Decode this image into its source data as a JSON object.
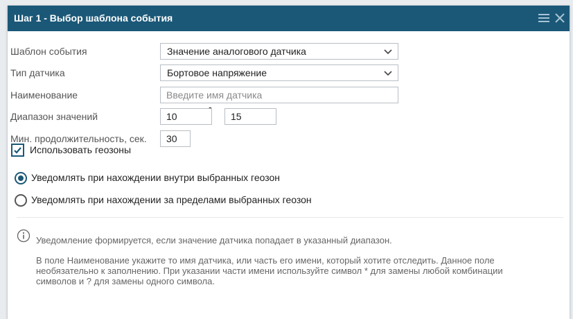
{
  "dialog": {
    "title": "Шаг 1 - Выбор шаблона события",
    "menu_icon": "hamburger-menu-icon",
    "close_icon": "close-icon"
  },
  "form": {
    "template_label": "Шаблон события",
    "template_value": "Значение аналогового датчика",
    "sensor_type_label": "Тип датчика",
    "sensor_type_value": "Бортовое напряжение",
    "name_label": "Наименование",
    "name_placeholder": "Введите имя датчика",
    "name_value": "",
    "range_label": "Диапазон значений",
    "range_from": "10",
    "range_sep": "-",
    "range_to": "15",
    "duration_label": "Мин. продолжительность, сек.",
    "duration_value": "30",
    "geozones_label": "Использовать геозоны",
    "geozones_checked": true,
    "radio_inside_label": "Уведомлять при нахождении внутри выбранных геозон",
    "radio_outside_label": "Уведомлять при нахождении за пределами выбранных геозон",
    "radio_selected": "inside"
  },
  "info": {
    "line1": "Уведомление формируется, если значение датчика попадает в указанный диапазон.",
    "paragraph": "В поле Наименование укажите то имя датчика, или часть его имени, который хотите отследить. Данное поле необязательно к заполнению. При указании части имени используйте символ * для замены любой комбинации символов и ? для замены одного символа."
  },
  "colors": {
    "header": "#1b5878",
    "accent": "#1b5878"
  }
}
